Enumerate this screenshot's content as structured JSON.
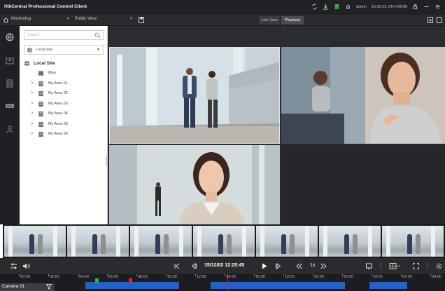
{
  "app": {
    "title": "HikCentral Professional Control Client"
  },
  "header": {
    "user": "admin",
    "time": "15:16:23 UTC+08:00"
  },
  "toolbar": {
    "module": "Monitoring",
    "view": "Public View",
    "tab_live": "Live View",
    "tab_playback": "Playback"
  },
  "panel": {
    "search_placeholder": "Search",
    "site_select": "Local Site",
    "root_label": "Local Site",
    "items": [
      {
        "label": "Map",
        "expandable": false,
        "icon": "map-icon"
      },
      {
        "label": "My Area 01",
        "expandable": true,
        "icon": "building-icon"
      },
      {
        "label": "My Area 02",
        "expandable": true,
        "icon": "building-icon"
      },
      {
        "label": "My Area 03",
        "expandable": true,
        "icon": "building-icon"
      },
      {
        "label": "My Area 04",
        "expandable": true,
        "icon": "building-icon"
      },
      {
        "label": "My Area 05",
        "expandable": true,
        "icon": "building-icon"
      },
      {
        "label": "My Area 06",
        "expandable": true,
        "icon": "building-icon"
      }
    ]
  },
  "playback": {
    "datetime": "15/12/02  12:25:45",
    "speed": "1x",
    "camera": "Camera 01"
  },
  "timeline": {
    "labels": [
      "00:00",
      "02:00",
      "04:00",
      "06:00",
      "08:00",
      "10:00",
      "12:00",
      "14:00",
      "16:00",
      "18:00",
      "20:00",
      "22:00",
      "24:00",
      "02:00",
      "04:00"
    ]
  },
  "colors": {
    "accent": "#1e64c8",
    "cursor": "#e02828",
    "marker_green": "#2fb34a",
    "marker_red": "#e02828",
    "titlebar_bg": "#202124"
  }
}
